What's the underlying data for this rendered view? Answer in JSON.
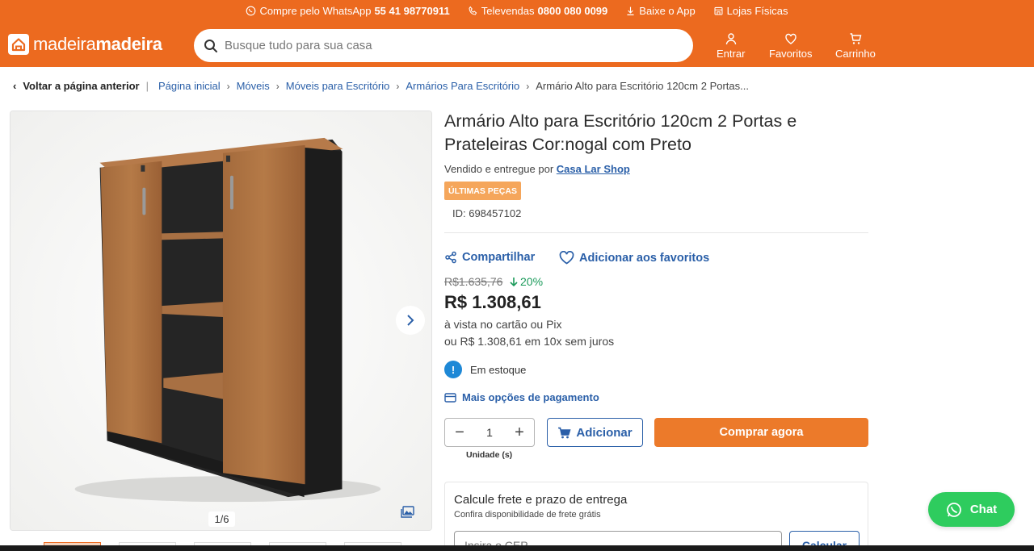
{
  "topbar": {
    "whatsapp_label": "Compre pelo WhatsApp",
    "whatsapp_number": "55 41 98770911",
    "phone_label": "Televendas",
    "phone_number": "0800 080 0099",
    "app_label": "Baixe o App",
    "stores_label": "Lojas Físicas"
  },
  "logo": {
    "part1": "madeira",
    "part2": "madeira"
  },
  "search": {
    "placeholder": "Busque tudo para sua casa"
  },
  "header_actions": {
    "login": "Entrar",
    "favorites": "Favoritos",
    "cart": "Carrinho"
  },
  "breadcrumb": {
    "back": "Voltar a página anterior",
    "items": [
      "Página inicial",
      "Móveis",
      "Móveis para Escritório",
      "Armários Para Escritório"
    ],
    "current": "Armário Alto para Escritório 120cm 2 Portas..."
  },
  "gallery": {
    "counter": "1/6"
  },
  "product": {
    "title": "Armário Alto para Escritório 120cm 2 Portas e Prateleiras Cor:nogal com Preto",
    "seller_prefix": "Vendido e entregue por",
    "seller_name": "Casa Lar Shop",
    "badge": "ÚLTIMAS PEÇAS",
    "id": "ID: 698457102",
    "share": "Compartilhar",
    "add_favorites": "Adicionar aos favoritos",
    "old_price": "R$1.635,76",
    "discount": "20%",
    "price": "R$ 1.308,61",
    "price_note": "à vista no cartão ou Pix",
    "installments": "ou R$ 1.308,61 em 10x sem juros",
    "stock": "Em estoque",
    "payment_options": "Mais opções de pagamento",
    "quantity": "1",
    "unit_label": "Unidade (s)",
    "add_button": "Adicionar",
    "buy_button": "Comprar agora"
  },
  "freight": {
    "title": "Calcule frete e prazo de entrega",
    "subtitle": "Confira disponibilidade de frete grátis",
    "placeholder": "Insira o CEP",
    "button": "Calcular"
  },
  "chat": {
    "label": "Chat"
  },
  "colors": {
    "brand_orange": "#ec6a1f",
    "link_blue": "#2a5fa8",
    "buy_orange": "#ec7a2a",
    "chat_green": "#2ecc5e"
  }
}
